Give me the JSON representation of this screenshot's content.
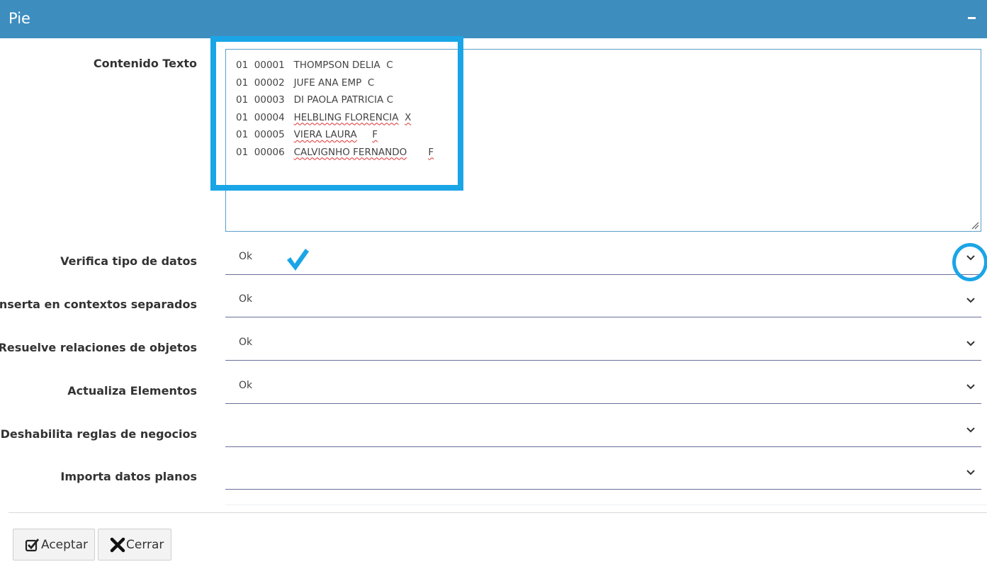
{
  "header": {
    "title": "Pie",
    "collapse_icon": "minus-icon"
  },
  "content_text": {
    "label": "Contenido Texto",
    "lines": [
      {
        "a": "01",
        "b": "00001",
        "name": "THOMPSON DELIA",
        "flag": "C"
      },
      {
        "a": "01",
        "b": "00002",
        "name": "JUFE ANA EMP",
        "flag": "C"
      },
      {
        "a": "01",
        "b": "00003",
        "name": "DI PAOLA PATRICIA",
        "flag": "C"
      },
      {
        "a": "01",
        "b": "00004",
        "name": "HELBLING FLORENCIA",
        "flag": "X"
      },
      {
        "a": "01",
        "b": "00005",
        "name": "VIERA LAURA",
        "flag": "F"
      },
      {
        "a": "01",
        "b": "00006",
        "name": "CALVIGNHO FERNANDO",
        "flag": "F"
      }
    ]
  },
  "fields": [
    {
      "label": "Verifica tipo de datos",
      "value": "Ok"
    },
    {
      "label": "Inserta en contextos separados",
      "value": "Ok"
    },
    {
      "label": "Resuelve relaciones de objetos",
      "value": "Ok"
    },
    {
      "label": "Actualiza Elementos",
      "value": "Ok"
    },
    {
      "label": "Deshabilita reglas de negocios",
      "value": ""
    },
    {
      "label": "Importa datos planos",
      "value": ""
    }
  ],
  "buttons": {
    "accept_label": "Aceptar",
    "close_label": "Cerrar"
  },
  "colors": {
    "header_bg": "#3d8dbf",
    "highlight": "#1aa5e6"
  }
}
